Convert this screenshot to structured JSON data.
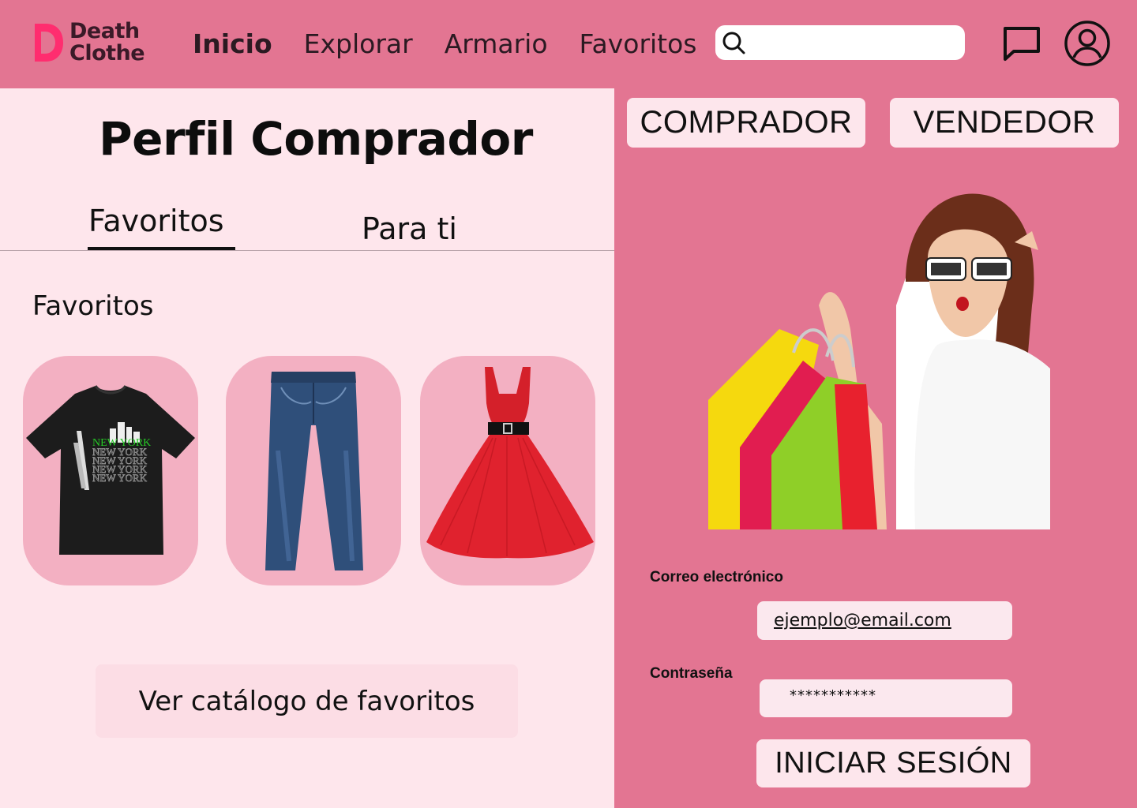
{
  "brand": {
    "line1": "Death",
    "line2": "Clothe"
  },
  "nav": {
    "items": [
      {
        "label": "Inicio",
        "active": true
      },
      {
        "label": "Explorar",
        "active": false
      },
      {
        "label": "Armario",
        "active": false
      },
      {
        "label": "Favoritos",
        "active": false
      }
    ]
  },
  "search": {
    "value": "",
    "icon": "search-icon"
  },
  "header_icons": [
    "chat-icon",
    "user-icon"
  ],
  "profile": {
    "title": "Perfil Comprador",
    "tabs": [
      {
        "label": "Favoritos",
        "selected": true
      },
      {
        "label": "Para ti",
        "selected": false
      }
    ],
    "section_label": "Favoritos",
    "products": [
      {
        "name": "tshirt",
        "print_text": "NEW YORK"
      },
      {
        "name": "jeans"
      },
      {
        "name": "dress"
      }
    ],
    "catalog_button": "Ver catálogo de favoritos"
  },
  "roles": {
    "buyer": "COMPRADOR",
    "seller": "VENDEDOR"
  },
  "login": {
    "email_label": "Correo electrónico",
    "email_value": "ejemplo@email.com",
    "password_label": "Contraseña",
    "password_value": "***********",
    "submit": "INICIAR SESIÓN"
  },
  "colors": {
    "brand_pink": "#e37592",
    "panel_light": "#fee6ec",
    "card_pink": "#f3b0c2",
    "logo_accent": "#ff2d6f"
  }
}
